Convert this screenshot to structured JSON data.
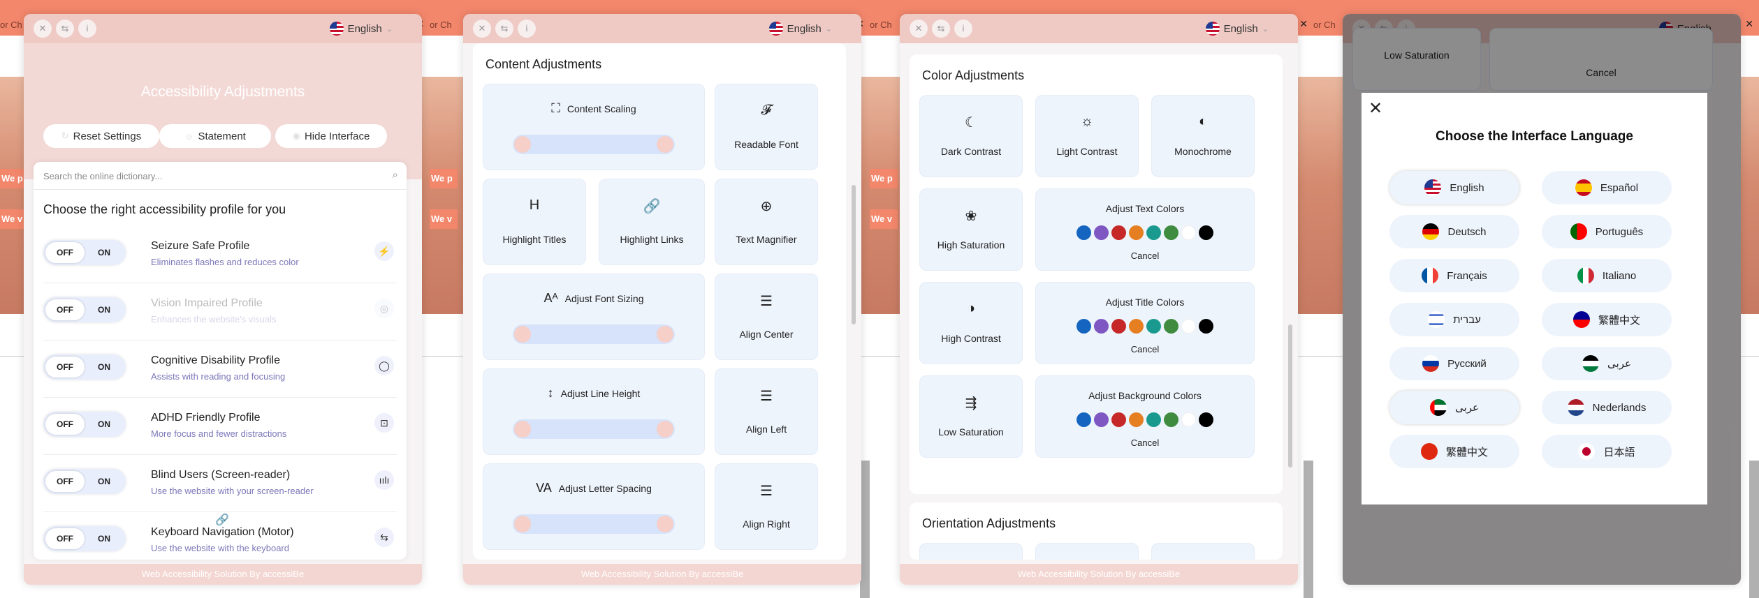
{
  "common": {
    "language": "English",
    "site_crumb": "or Ch",
    "site_promo_1": "We p",
    "site_promo_2": "We v"
  },
  "screen1": {
    "title": "Accessibility Adjustments",
    "reset_label": "Reset Settings",
    "statement_label": "Statement",
    "hide_label": "Hide Interface",
    "search_placeholder": "Search the online dictionary...",
    "choose_label": "Choose the right accessibility profile for you",
    "toggle_off": "OFF",
    "toggle_on": "ON",
    "profiles": [
      {
        "name": "Seizure Safe Profile",
        "desc": "Eliminates flashes and reduces color",
        "icon": "no-flash-icon"
      },
      {
        "name": "Vision Impaired Profile",
        "desc": "Enhances the website's visuals",
        "icon": "eye-icon"
      },
      {
        "name": "Cognitive Disability Profile",
        "desc": "Assists with reading and focusing",
        "icon": "brain-icon"
      },
      {
        "name": "ADHD Friendly Profile",
        "desc": "More focus and fewer distractions",
        "icon": "focus-icon"
      },
      {
        "name": "Blind Users (Screen-reader)",
        "desc": "Use the website with your screen-reader",
        "icon": "soundwave-icon"
      },
      {
        "name": "Keyboard Navigation (Motor)",
        "desc": "Use the website with the keyboard",
        "icon": "arrows-icon"
      }
    ],
    "footer": "Web Accessibility Solution By accessiBe"
  },
  "screen2": {
    "section_title": "Content Adjustments",
    "tiles": {
      "content_scaling": "Content Scaling",
      "readable_font": "Readable Font",
      "highlight_titles": "Highlight Titles",
      "highlight_links": "Highlight Links",
      "text_magnifier": "Text Magnifier",
      "adjust_font_sizing": "Adjust Font Sizing",
      "align_center": "Align Center",
      "adjust_line_height": "Adjust Line Height",
      "align_left": "Align Left",
      "adjust_letter_spacing": "Adjust Letter Spacing",
      "align_right": "Align Right"
    },
    "footer": "Web Accessibility Solution By accessiBe"
  },
  "screen3": {
    "section_title": "Color Adjustments",
    "tiles": {
      "dark_contrast": "Dark Contrast",
      "light_contrast": "Light Contrast",
      "monochrome": "Monochrome",
      "high_saturation": "High Saturation",
      "high_contrast": "High Contrast",
      "low_saturation": "Low Saturation",
      "adjust_text_colors": "Adjust Text Colors",
      "adjust_title_colors": "Adjust Title Colors",
      "adjust_background_colors": "Adjust Background Colors"
    },
    "cancel_label": "Cancel",
    "swatch_colors": [
      "#1565c0",
      "#7e57c2",
      "#c62828",
      "#e67e22",
      "#1a9a8f",
      "#3f8b3f",
      "#ffffff",
      "#000000"
    ],
    "section2_title": "Orientation Adjustments",
    "footer": "Web Accessibility Solution By accessiBe"
  },
  "screen4": {
    "bg_low_saturation": "Low Saturation",
    "bg_cancel": "Cancel",
    "modal_title": "Choose the Interface Language",
    "languages": [
      {
        "label": "English",
        "flag": "us-flag"
      },
      {
        "label": "Español",
        "flag": "spain-flag"
      },
      {
        "label": "Deutsch",
        "flag": "germany-flag"
      },
      {
        "label": "Português",
        "flag": "portugal-flag"
      },
      {
        "label": "Français",
        "flag": "france-flag"
      },
      {
        "label": "Italiano",
        "flag": "italy-flag"
      },
      {
        "label": "עברית",
        "flag": "israel-flag"
      },
      {
        "label": "繁體中文",
        "flag": "taiwan-flag"
      },
      {
        "label": "Русский",
        "flag": "russia-flag"
      },
      {
        "label": "عربى",
        "flag": "jordan-flag"
      },
      {
        "label": "عربى",
        "flag": "uae-flag"
      },
      {
        "label": "Nederlands",
        "flag": "netherlands-flag"
      },
      {
        "label": "繁體中文",
        "flag": "china-flag"
      },
      {
        "label": "日本語",
        "flag": "japan-flag"
      }
    ]
  }
}
